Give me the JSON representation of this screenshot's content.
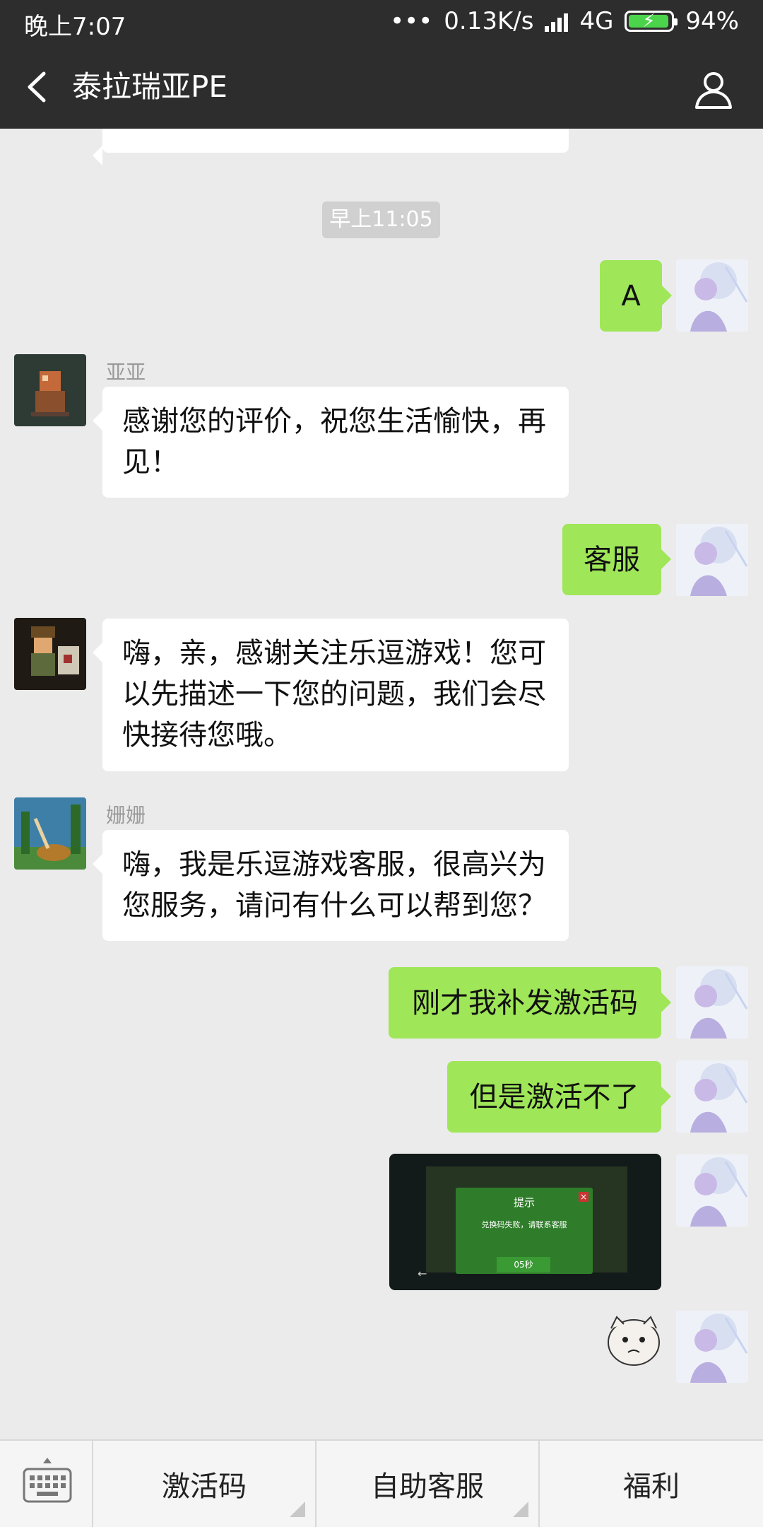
{
  "status_bar": {
    "time": "晚上7:07",
    "dots": "•••",
    "speed": "0.13K/s",
    "network": "4G",
    "battery": "94%"
  },
  "header": {
    "title": "泰拉瑞亚PE",
    "back_icon": "chevron-left-icon",
    "profile_icon": "user-icon"
  },
  "chat": {
    "timestamp": "早上11:05",
    "messages": [
      {
        "side": "right",
        "text": "A"
      },
      {
        "side": "left",
        "sender": "亚亚",
        "text": "感谢您的评价，祝您生活愉快，再见！"
      },
      {
        "side": "right",
        "text": "客服"
      },
      {
        "side": "left",
        "text": "嗨，亲，感谢关注乐逗游戏！您可以先描述一下您的问题，我们会尽快接待您哦。"
      },
      {
        "side": "left",
        "sender": "姗姗",
        "text": "嗨，我是乐逗游戏客服，很高兴为您服务，请问有什么可以帮到您？"
      },
      {
        "side": "right",
        "text": "刚才我补发激活码"
      },
      {
        "side": "right",
        "text": "但是激活不了"
      }
    ],
    "screenshot": {
      "dialog_title": "提示",
      "dialog_message": "兑换码失败，请联系客服",
      "countdown": "05秒"
    }
  },
  "bottom_menu": {
    "keyboard_icon": "keyboard-icon",
    "items": [
      "激活码",
      "自助客服",
      "福利"
    ]
  },
  "colors": {
    "header_bg": "#2d2d2d",
    "chat_bg": "#ebebeb",
    "sent_bubble": "#9fe658",
    "received_bubble": "#ffffff"
  }
}
